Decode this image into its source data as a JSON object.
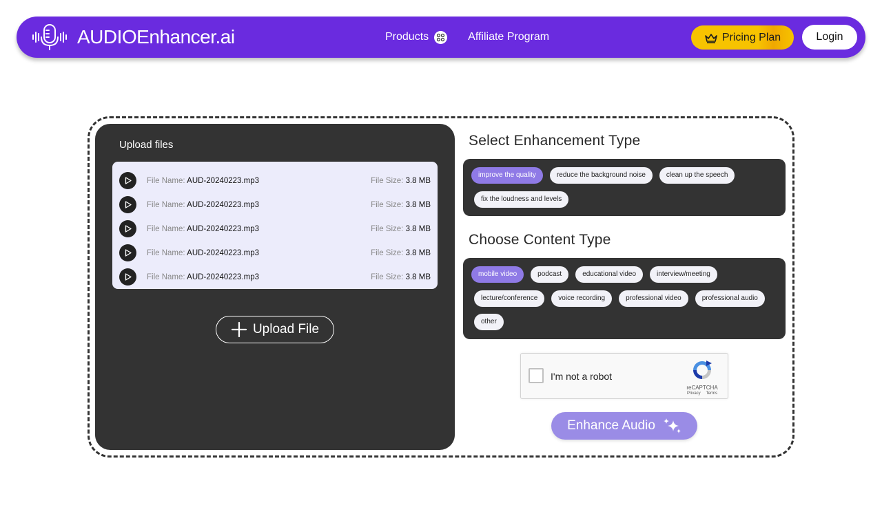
{
  "header": {
    "logo_text": "AUDIOEnhancer.ai",
    "nav": [
      {
        "label": "Products"
      },
      {
        "label": "Affiliate Program"
      }
    ],
    "pricing_label": "Pricing Plan",
    "login_label": "Login"
  },
  "upload": {
    "title": "Upload files",
    "name_label": "File Name:",
    "size_label": "File Size:",
    "files": [
      {
        "name": "AUD-20240223.mp3",
        "size": "3.8 MB"
      },
      {
        "name": "AUD-20240223.mp3",
        "size": "3.8 MB"
      },
      {
        "name": "AUD-20240223.mp3",
        "size": "3.8 MB"
      },
      {
        "name": "AUD-20240223.mp3",
        "size": "3.8 MB"
      },
      {
        "name": "AUD-20240223.mp3",
        "size": "3.8 MB"
      }
    ],
    "upload_button": "Upload File"
  },
  "enhancement": {
    "title": "Select Enhancement Type",
    "options": [
      {
        "label": "improve the quality",
        "selected": true
      },
      {
        "label": "reduce the background noise",
        "selected": false
      },
      {
        "label": "clean up the speech",
        "selected": false
      },
      {
        "label": "fix the loudness and levels",
        "selected": false
      }
    ]
  },
  "content": {
    "title": "Choose Content Type",
    "options": [
      {
        "label": "mobile video",
        "selected": true
      },
      {
        "label": "podcast",
        "selected": false
      },
      {
        "label": "educational video",
        "selected": false
      },
      {
        "label": "interview/meeting",
        "selected": false
      },
      {
        "label": "lecture/conference",
        "selected": false
      },
      {
        "label": "voice recording",
        "selected": false
      },
      {
        "label": "professional video",
        "selected": false
      },
      {
        "label": "professional audio",
        "selected": false
      },
      {
        "label": "other",
        "selected": false
      }
    ]
  },
  "captcha": {
    "label": "I'm not a robot",
    "brand": "reCAPTCHA",
    "privacy": "Privacy",
    "terms": "Terms"
  },
  "enhance_button": "Enhance Audio",
  "colors": {
    "brand_purple": "#6a2bdf",
    "selected_chip": "#8f7ae6",
    "panel_dark": "#333333",
    "pricing_yellow": "#f7c300",
    "enhance_button": "#9a8ce6"
  }
}
